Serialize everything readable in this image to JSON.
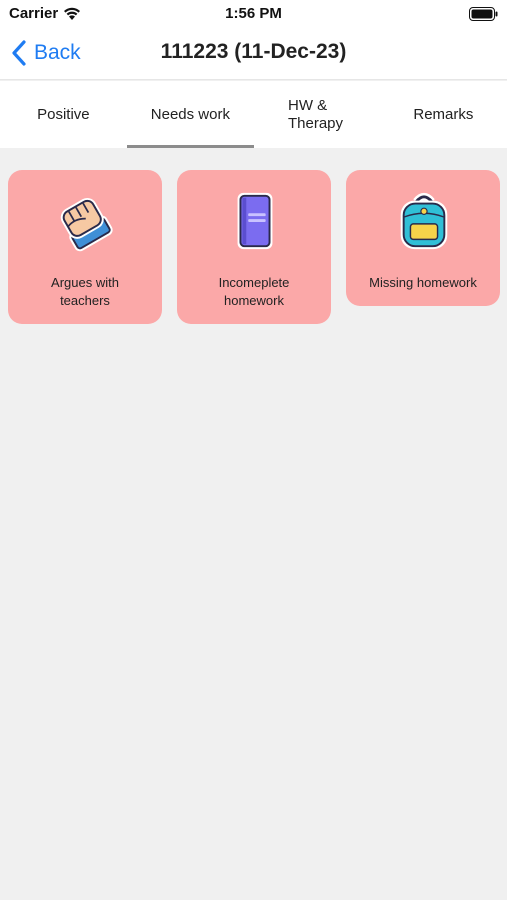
{
  "status_bar": {
    "carrier": "Carrier",
    "time": "1:56 PM",
    "icons": [
      "wifi-icon",
      "battery-icon"
    ]
  },
  "nav": {
    "back_label": "Back",
    "title": "111223 (11-Dec-23)"
  },
  "tabs": [
    {
      "label": "Positive"
    },
    {
      "label": "Needs work",
      "selected": true
    },
    {
      "label_line1": "HW &",
      "label_line2": "Therapy"
    },
    {
      "label": "Remarks"
    }
  ],
  "cards": [
    {
      "label_line1": "Argues with",
      "label_line2": "teachers",
      "icon": "fist-icon"
    },
    {
      "label_line1": "Incomeplete",
      "label_line2": "homework",
      "icon": "book-icon"
    },
    {
      "label": "Missing homework",
      "icon": "backpack-icon"
    }
  ],
  "colors": {
    "accent": "#1f7cf2",
    "card_background": "#fba8a8",
    "page_background": "#f0f0f0",
    "tab_indicator": "#8c8c8c"
  }
}
